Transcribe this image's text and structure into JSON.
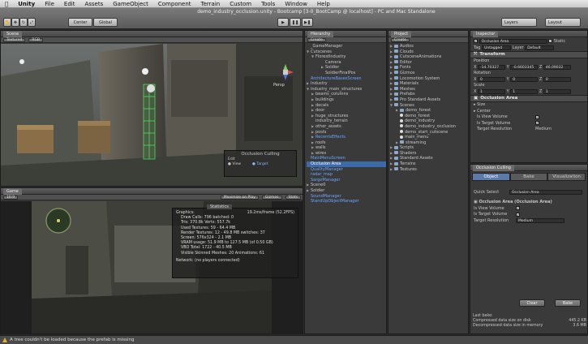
{
  "menubar": {
    "apple": "",
    "items": [
      "Unity",
      "File",
      "Edit",
      "Assets",
      "GameObject",
      "Component",
      "Terrain",
      "Custom",
      "Tools",
      "Window",
      "Help"
    ]
  },
  "window_title": "demo_industry_occlusion.unity - Bootcamp [3-0_BootCamp @ localhost] - PC and Mac Standalone",
  "toolbar": {
    "center": "Center",
    "global": "Global",
    "layers": "Layers",
    "layout": "Layout"
  },
  "scene": {
    "tab": "Scene",
    "draw_mode": "Textured",
    "color_mode": "RGB",
    "persp": "Persp",
    "occlusion": {
      "title": "Occlusion Culling",
      "edit": "Edit",
      "view": "View",
      "target": "Target"
    }
  },
  "game": {
    "tab": "Game",
    "aspect": "16:9",
    "maximize": "Maximize on Play",
    "gizmos": "Gizmos",
    "stats_btn": "Stats",
    "stats": {
      "header": "Statistics",
      "graphics_label": "Graphics:",
      "graphics_value": "19.2ms/frame (52.2FPS)",
      "lines": [
        "Draw Calls: 796  batched: 0",
        "Tris: 370.8k  Verts: 557.7k",
        "Used Textures: 59 - 64.4 MB",
        "Render Textures: 12 - 49.8 MB  switches: 37",
        "Screen: 576x324 - 2.1 MB",
        "VRAM usage: 51.9 MB to 127.5 MB (of 0.50 GB)",
        "VBO Total: 1722 - 40.5 MB",
        "Visible Skinned Meshes: 20    Animations: 61"
      ],
      "network": "Network: (no players connected)"
    }
  },
  "hierarchy": {
    "tab": "Hierarchy",
    "create": "Create",
    "rows": [
      {
        "t": "_GameManager",
        "i": 0,
        "c": ""
      },
      {
        "t": "Cutscenes",
        "i": 0,
        "c": "",
        "open": true
      },
      {
        "t": "FlorestIndustry",
        "i": 1,
        "c": "",
        "open": true
      },
      {
        "t": "Camera",
        "i": 3,
        "c": ""
      },
      {
        "t": "Soldier",
        "i": 3,
        "c": "",
        "tri": true
      },
      {
        "t": "SoldierFinalPos",
        "i": 3,
        "c": ""
      },
      {
        "t": "ArchitectureBasesScreen",
        "i": 0,
        "c": "blue"
      },
      {
        "t": "Industry",
        "i": 0,
        "c": "",
        "tri": true
      },
      {
        "t": "industry_main_structures",
        "i": 0,
        "c": "",
        "open": true
      },
      {
        "t": "beams_columns",
        "i": 1,
        "c": "",
        "tri": true
      },
      {
        "t": "buildings",
        "i": 1,
        "c": "",
        "tri": true
      },
      {
        "t": "decals",
        "i": 1,
        "c": "",
        "tri": true
      },
      {
        "t": "door",
        "i": 1,
        "c": "",
        "tri": true
      },
      {
        "t": "huge_structures",
        "i": 1,
        "c": "",
        "tri": true
      },
      {
        "t": "industry_terrain",
        "i": 1,
        "c": ""
      },
      {
        "t": "other_assets",
        "i": 1,
        "c": "",
        "tri": true
      },
      {
        "t": "posts",
        "i": 1,
        "c": "",
        "tri": true
      },
      {
        "t": "RecentsEffects",
        "i": 1,
        "c": "blue",
        "tri": true
      },
      {
        "t": "roofs",
        "i": 1,
        "c": "",
        "tri": true
      },
      {
        "t": "walls",
        "i": 1,
        "c": "",
        "tri": true
      },
      {
        "t": "wires",
        "i": 1,
        "c": "",
        "tri": true
      },
      {
        "t": "MainMenuScreen",
        "i": 0,
        "c": "blue"
      },
      {
        "t": "Occlusion Area",
        "i": 0,
        "c": "sel"
      },
      {
        "t": "QualityManager",
        "i": 0,
        "c": "blue"
      },
      {
        "t": "radar_map",
        "i": 0,
        "c": "blue"
      },
      {
        "t": "SargeManager",
        "i": 0,
        "c": "blue"
      },
      {
        "t": "Scene0",
        "i": 0,
        "c": "",
        "tri": true
      },
      {
        "t": "Soldier",
        "i": 0,
        "c": "",
        "tri": true
      },
      {
        "t": "SoundManager",
        "i": 0,
        "c": "blue"
      },
      {
        "t": "StandUpObjectManager",
        "i": 0,
        "c": "blue"
      }
    ]
  },
  "project": {
    "tab": "Project",
    "create": "Create",
    "rows": [
      {
        "t": "Audios",
        "i": 0,
        "k": "f"
      },
      {
        "t": "Clouds",
        "i": 0,
        "k": "f"
      },
      {
        "t": "CutsceneAnimations",
        "i": 0,
        "k": "f"
      },
      {
        "t": "Editor",
        "i": 0,
        "k": "f"
      },
      {
        "t": "Fonts",
        "i": 0,
        "k": "f"
      },
      {
        "t": "Gizmos",
        "i": 0,
        "k": "f"
      },
      {
        "t": "Locomotion System",
        "i": 0,
        "k": "f"
      },
      {
        "t": "Materials",
        "i": 0,
        "k": "f"
      },
      {
        "t": "Meshes",
        "i": 0,
        "k": "f"
      },
      {
        "t": "Prefabs",
        "i": 0,
        "k": "f"
      },
      {
        "t": "Pro Standard Assets",
        "i": 0,
        "k": "f"
      },
      {
        "t": "Scenes",
        "i": 0,
        "k": "f",
        "open": true
      },
      {
        "t": "demo_forest",
        "i": 1,
        "k": "f"
      },
      {
        "t": "demo_forest",
        "i": 1,
        "k": "s"
      },
      {
        "t": "demo_industry",
        "i": 1,
        "k": "s"
      },
      {
        "t": "demo_industry_occlusion",
        "i": 1,
        "k": "s"
      },
      {
        "t": "demo_start_cutscene",
        "i": 1,
        "k": "s"
      },
      {
        "t": "main_menu",
        "i": 1,
        "k": "s"
      },
      {
        "t": "streaming",
        "i": 1,
        "k": "f"
      },
      {
        "t": "Scripts",
        "i": 0,
        "k": "f"
      },
      {
        "t": "Shaders",
        "i": 0,
        "k": "f"
      },
      {
        "t": "Standard Assets",
        "i": 0,
        "k": "f"
      },
      {
        "t": "Terrains",
        "i": 0,
        "k": "f"
      },
      {
        "t": "Textures",
        "i": 0,
        "k": "f"
      }
    ]
  },
  "inspector": {
    "tab": "Inspector",
    "object_name": "Occlusion Area",
    "static": "Static",
    "tag_label": "Tag",
    "tag": "Untagged",
    "layer_label": "Layer",
    "layer": "Default",
    "transform": "Transform",
    "position": "Position",
    "rotation": "Rotation",
    "scale": "Scale",
    "pos": {
      "x": "-14.70327",
      "y": "-0.6603345",
      "z": "46.09032"
    },
    "rot": {
      "x": "0",
      "y": "0",
      "z": "0"
    },
    "scl": {
      "x": "1",
      "y": "1",
      "z": "1"
    },
    "oa_title": "Occlusion Area",
    "size": "Size",
    "center": "Center",
    "is_view_volume": "Is View Volume",
    "is_target_volume": "Is Target Volume",
    "target_resolution": "Target Resolution",
    "target_resolution_value": "Medium"
  },
  "occl": {
    "tab": "Occlusion Culling",
    "tabs": [
      "Object",
      "Bake",
      "Visualization"
    ],
    "quick_select_label": "Quick Select",
    "quick_select": "Occlusion Area",
    "oa_label": "Occlusion Area (Occlusion Area)",
    "is_view_volume": "Is View Volume",
    "is_target_volume": "Is Target Volume",
    "target_resolution": "Target Resolution",
    "target_resolution_value": "Medium",
    "clear": "Clear",
    "bake": "Bake",
    "last_bake": "Last bake:",
    "compressed_label": "Compressed data size on disk",
    "compressed_value": "445.2 KB",
    "decompressed_label": "Decompressed data size in memory",
    "decompressed_value": "3.6 MB"
  },
  "status": {
    "message": "A tree couldn't be loaded because the prefab is missing"
  },
  "colors": {
    "selection": "#3d6aa8",
    "prefab_blue": "#6aa6ff",
    "warning": "#e0b030"
  }
}
